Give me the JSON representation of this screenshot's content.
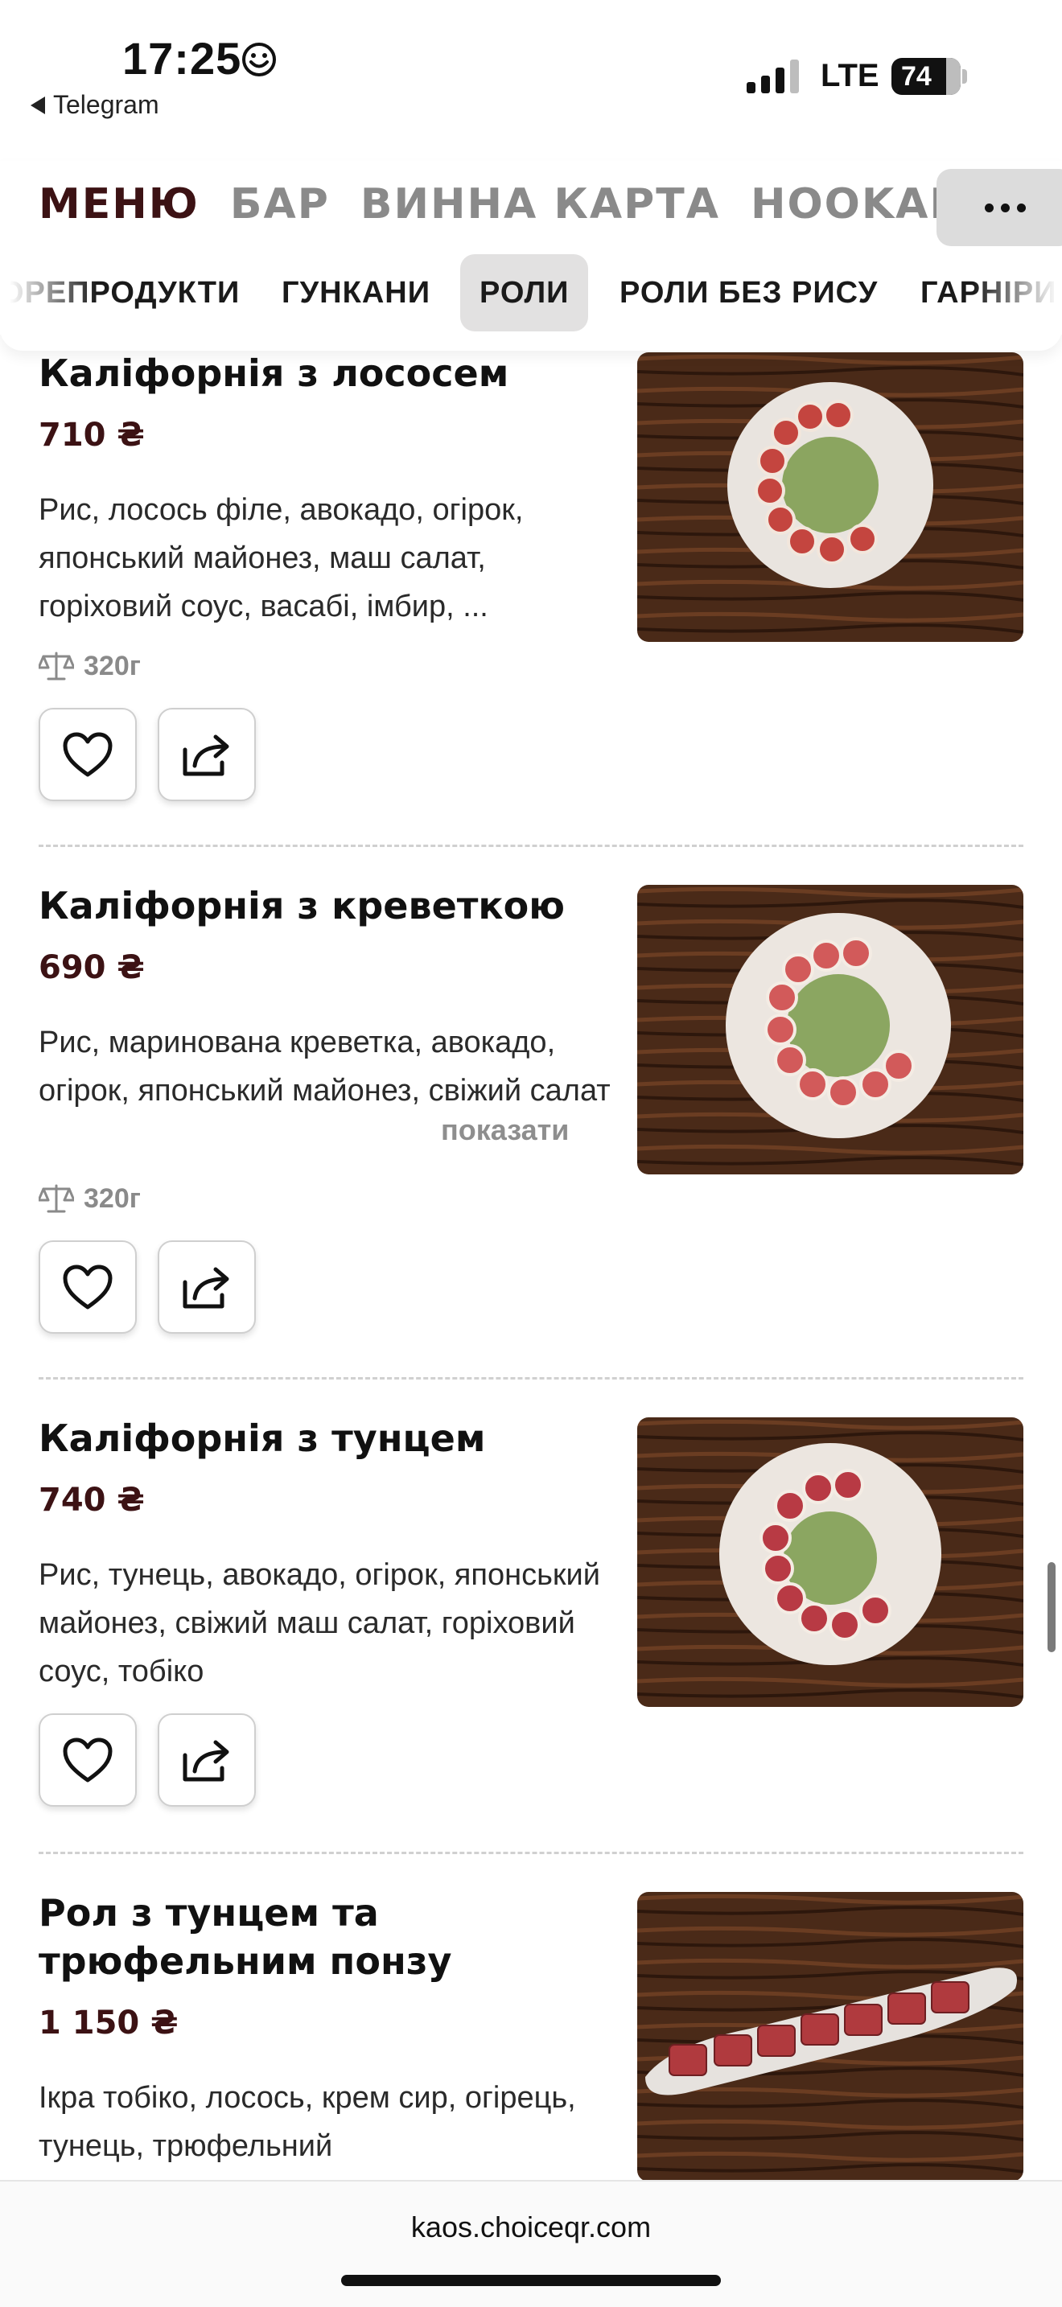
{
  "status_bar": {
    "time": "17:25",
    "back_app": "Telegram",
    "network": "LTE",
    "battery": "74"
  },
  "main_tabs": [
    {
      "label": "МЕНЮ",
      "active": true
    },
    {
      "label": "БАР",
      "active": false
    },
    {
      "label": "ВИННА КАРТА",
      "active": false
    },
    {
      "label": "HOOKAH",
      "active": false
    }
  ],
  "sub_tabs": [
    {
      "label": "ОРЕПРОДУКТИ",
      "active": false
    },
    {
      "label": "ГУНКАНИ",
      "active": false
    },
    {
      "label": "РОЛИ",
      "active": true
    },
    {
      "label": "РОЛИ БЕЗ РИСУ",
      "active": false
    },
    {
      "label": "ГАРНІРИ",
      "active": false
    }
  ],
  "items": [
    {
      "name": "Каліфорнія з лососем",
      "price": "710 ₴",
      "description": "Рис, лосось філе, авокадо, огірок, японський майонез, маш салат, горіховий соус, васабі, імбир, ...",
      "weight": "320г"
    },
    {
      "name": "Каліфорнія з креветкою",
      "price": "690 ₴",
      "description": "Рис, маринована креветка, авокадо, огірок, японський майонез, свіжий салат",
      "show_more": "показати",
      "weight": "320г"
    },
    {
      "name": "Каліфорнія з тунцем",
      "price": "740 ₴",
      "description": "Рис, тунець, авокадо, огірок, японський майонез, свіжий маш салат, горіховий соус, тобіко"
    },
    {
      "name": "Рол з тунцем та трюфельним понзу",
      "price": "1 150 ₴",
      "description": "Ікра тобіко, лосось, крем сир, огірець, тунець, трюфельний"
    }
  ],
  "url_bar": {
    "url": "kaos.choiceqr.com"
  },
  "colors": {
    "accent": "#3c1214",
    "muted": "#8a8a8a",
    "wood": "#4a2a18",
    "plate": "#e9e4df"
  }
}
